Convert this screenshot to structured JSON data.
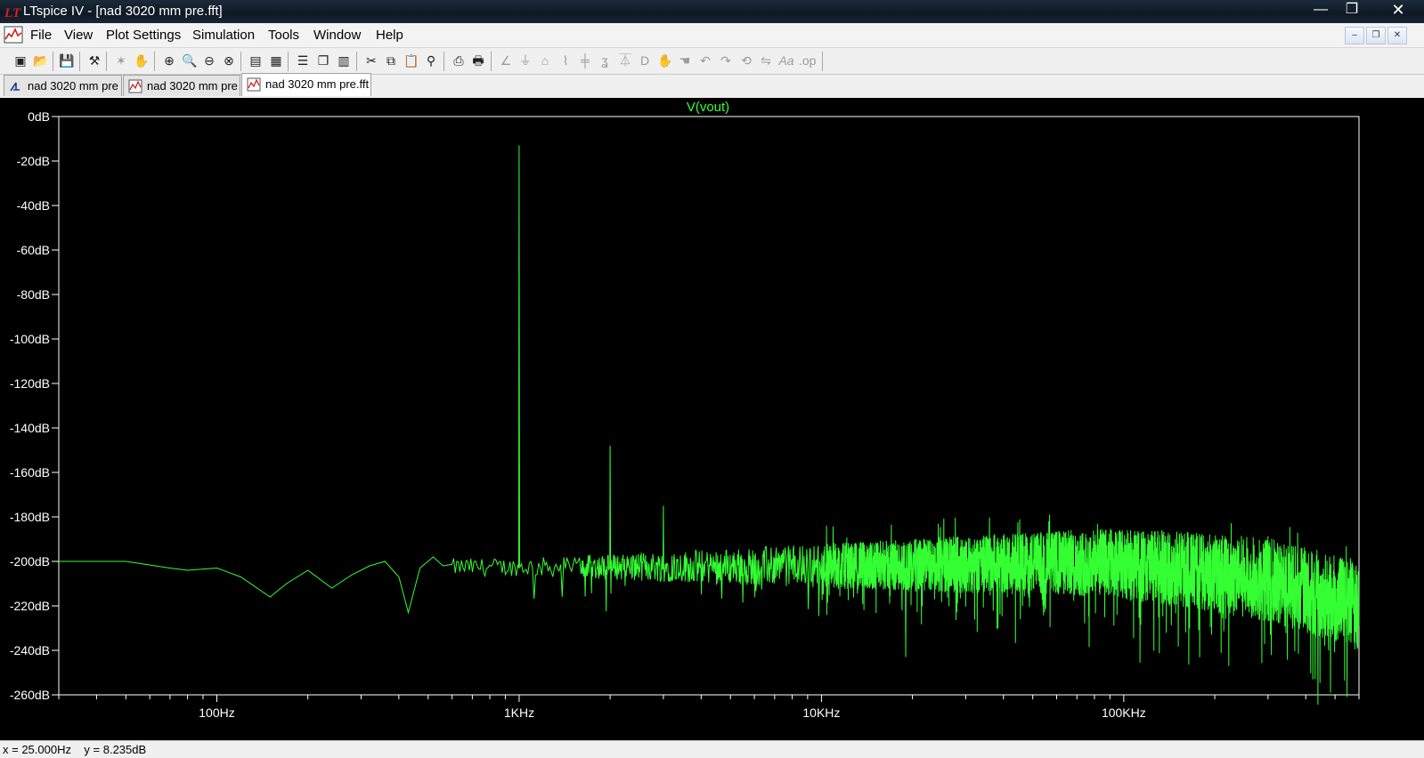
{
  "window": {
    "title": "LTspice IV - [nad 3020 mm pre.fft]",
    "minimize_glyph": "—",
    "maximize_glyph": "❐",
    "close_glyph": "✕"
  },
  "menu": {
    "items": [
      "File",
      "View",
      "Plot Settings",
      "Simulation",
      "Tools",
      "Window",
      "Help"
    ],
    "mdi_controls": [
      "–",
      "❐",
      "✕"
    ]
  },
  "toolbar": {
    "icons": [
      "new-schematic-icon",
      "open-icon",
      "save-icon",
      "control-panel-icon",
      "run-icon",
      "halt-icon",
      "zoom-in-icon",
      "zoom-area-icon",
      "zoom-out-icon",
      "zoom-fit-icon",
      "autorange-icon",
      "pick-traces-icon",
      "tile-horizontal-icon",
      "cascade-icon",
      "tile-vertical-icon",
      "cut-icon",
      "copy-icon",
      "paste-icon",
      "find-icon",
      "print-preview-icon",
      "print-icon",
      "wire-icon",
      "ground-icon",
      "label-icon",
      "resistor-icon",
      "capacitor-icon",
      "inductor-icon",
      "diode-icon",
      "component-icon",
      "move-icon",
      "drag-icon",
      "undo-icon",
      "redo-icon",
      "rotate-icon",
      "mirror-icon",
      "text-icon",
      "spice-directive-icon"
    ]
  },
  "tabs": [
    {
      "label": "nad 3020 mm pre",
      "icon": "schematic-icon",
      "active": false
    },
    {
      "label": "nad 3020 mm pre",
      "icon": "waveform-icon",
      "active": false
    },
    {
      "label": "nad 3020 mm pre.fft",
      "icon": "fft-icon",
      "active": true
    }
  ],
  "statusbar": {
    "text": "x = 25.000Hz    y = 8.235dB"
  },
  "colors": {
    "trace": "#33ff33",
    "plot_bg": "#000000",
    "grid_frame": "#ffffff"
  },
  "chart_data": {
    "type": "line",
    "title": "V(vout)",
    "x_scale": "log",
    "xlim": [
      30,
      600000
    ],
    "ylim": [
      -260,
      0
    ],
    "x_ticks": [
      {
        "value": 100,
        "label": "100Hz"
      },
      {
        "value": 1000,
        "label": "1KHz"
      },
      {
        "value": 10000,
        "label": "10KHz"
      },
      {
        "value": 100000,
        "label": "100KHz"
      }
    ],
    "y_ticks": [
      {
        "value": 0,
        "label": "0dB"
      },
      {
        "value": -20,
        "label": "-20dB"
      },
      {
        "value": -40,
        "label": "-40dB"
      },
      {
        "value": -60,
        "label": "-60dB"
      },
      {
        "value": -80,
        "label": "-80dB"
      },
      {
        "value": -100,
        "label": "-100dB"
      },
      {
        "value": -120,
        "label": "-120dB"
      },
      {
        "value": -140,
        "label": "-140dB"
      },
      {
        "value": -160,
        "label": "-160dB"
      },
      {
        "value": -180,
        "label": "-180dB"
      },
      {
        "value": -200,
        "label": "-200dB"
      },
      {
        "value": -220,
        "label": "-220dB"
      },
      {
        "value": -240,
        "label": "-240dB"
      },
      {
        "value": -260,
        "label": "-260dB"
      }
    ],
    "series": [
      {
        "name": "V(vout)",
        "color": "#33ff33",
        "low_freq_points": [
          [
            30,
            -200
          ],
          [
            50,
            -200
          ],
          [
            70,
            -203
          ],
          [
            80,
            -204
          ],
          [
            100,
            -203
          ],
          [
            120,
            -207
          ],
          [
            150,
            -216
          ],
          [
            170,
            -210
          ],
          [
            200,
            -204
          ],
          [
            240,
            -212
          ],
          [
            280,
            -206
          ],
          [
            320,
            -202
          ],
          [
            360,
            -200
          ],
          [
            400,
            -207
          ],
          [
            430,
            -223
          ],
          [
            470,
            -203
          ],
          [
            520,
            -198
          ],
          [
            560,
            -202
          ]
        ],
        "peaks": [
          {
            "freq": 1000,
            "db": -13
          },
          {
            "freq": 2000,
            "db": -148
          },
          {
            "freq": 3000,
            "db": -175
          },
          {
            "freq": 19000,
            "db": -243
          }
        ],
        "noise_floor": [
          [
            600,
            -203
          ],
          [
            1000,
            -203
          ],
          [
            5000,
            -203
          ],
          [
            20000,
            -203
          ],
          [
            80000,
            -202
          ],
          [
            150000,
            -205
          ],
          [
            300000,
            -210
          ],
          [
            600000,
            -222
          ]
        ]
      }
    ]
  }
}
